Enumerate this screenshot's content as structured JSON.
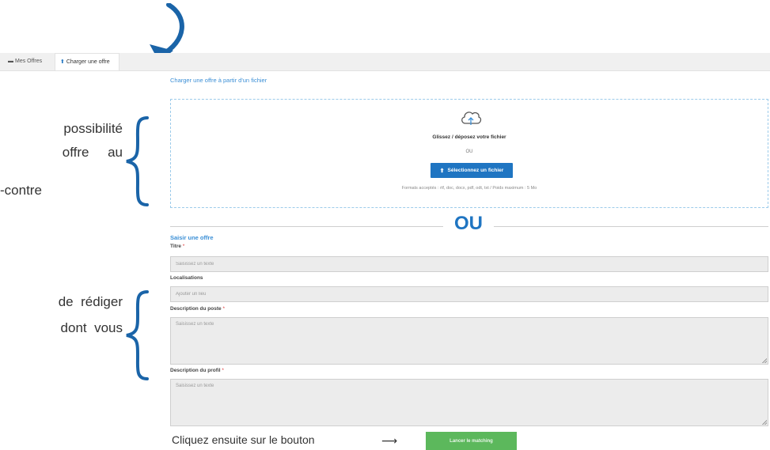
{
  "tabs": [
    {
      "label": "Mes Offres",
      "icon": "folder-icon"
    },
    {
      "label": "Charger une offre",
      "icon": "user-upload-icon",
      "active": true
    }
  ],
  "upload": {
    "title": "Charger une offre à partir d'un fichier",
    "drop_text": "Glissez / déposez votre fichier",
    "or_small": "OU",
    "select_button": "Sélectionnez un fichier",
    "formats": "Formats acceptés : rtf, doc, docx, pdf, odt, txt / Poids maximum : 5 Mo"
  },
  "separator": {
    "label": "OU"
  },
  "form": {
    "title": "Saisir une offre",
    "fields": [
      {
        "label": "Titre",
        "required": true,
        "placeholder": "Saisissez un texte"
      },
      {
        "label": "Localisations",
        "required": false,
        "placeholder": "Ajouter un lieu"
      },
      {
        "label": "Description du poste",
        "required": true,
        "placeholder": "Saisissez un texte"
      },
      {
        "label": "Description du profil",
        "required": true,
        "placeholder": "Saisissez un texte"
      }
    ],
    "required_marker": "*",
    "launch_button": "Lancer le matching"
  },
  "annotations": {
    "upload_lines": [
      "possibilité",
      "offre     au",
      "-contre"
    ],
    "form_lines": [
      "de  rédiger",
      "dont  vous"
    ],
    "bottom_hint": "Cliquez ensuite sur le bouton",
    "arrow": "⟶"
  },
  "colors": {
    "accent_blue": "#1f75c2",
    "annotation_blue": "#1a64a8",
    "launch_green": "#5cb85c",
    "dropzone_border": "#9ccbea"
  }
}
